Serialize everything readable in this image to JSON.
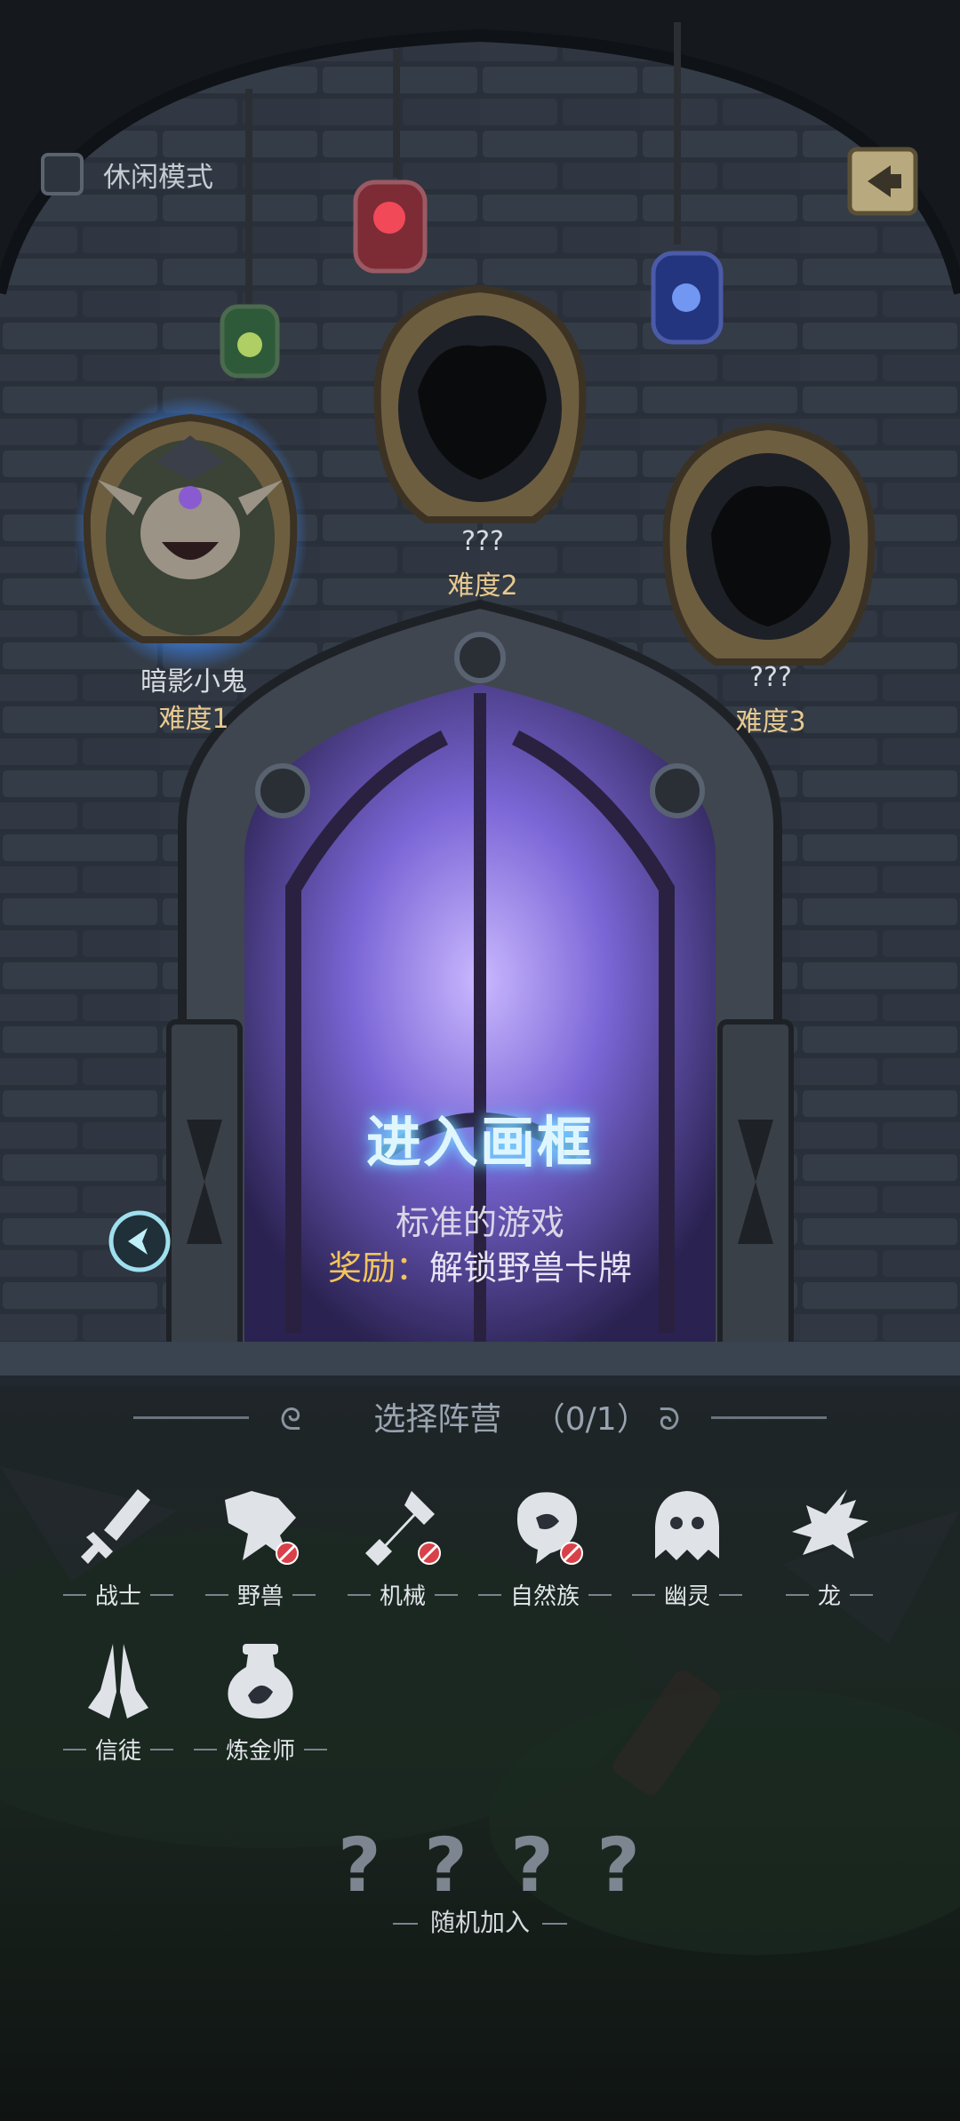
{
  "top": {
    "casual_mode_label": "休闲模式",
    "casual_mode_checked": false,
    "back_icon": "back-arrow-icon"
  },
  "portraits": [
    {
      "name": "暗影小鬼",
      "difficulty": "难度1",
      "unlocked": true,
      "selected": true
    },
    {
      "name": "???",
      "difficulty": "难度2",
      "unlocked": false,
      "selected": false
    },
    {
      "name": "???",
      "difficulty": "难度3",
      "unlocked": false,
      "selected": false
    }
  ],
  "door": {
    "title": "进入画框",
    "description": "标准的游戏",
    "reward_key": "奖励：",
    "reward_value": "解锁野兽卡牌"
  },
  "factions": {
    "header": "选择阵营",
    "count": "（0/1）",
    "items": [
      {
        "label": "战士",
        "icon": "warrior-icon",
        "locked": false
      },
      {
        "label": "野兽",
        "icon": "beast-icon",
        "locked": true
      },
      {
        "label": "机械",
        "icon": "mech-icon",
        "locked": true
      },
      {
        "label": "自然族",
        "icon": "nature-icon",
        "locked": true
      },
      {
        "label": "幽灵",
        "icon": "ghost-icon",
        "locked": false
      },
      {
        "label": "龙",
        "icon": "dragon-icon",
        "locked": false
      },
      {
        "label": "信徒",
        "icon": "believer-icon",
        "locked": false
      },
      {
        "label": "炼金师",
        "icon": "alchemist-icon",
        "locked": false
      }
    ]
  },
  "random": {
    "marks": [
      "?",
      "?",
      "?",
      "?"
    ],
    "label": "随机加入"
  },
  "colors": {
    "wall": "#2a313b",
    "door_glow": "#8f7cff",
    "title_glow": "#7fd8ff",
    "selected_glow": "#3e8cff",
    "reward_key": "#f2c45d",
    "difficulty": "#e8c98f",
    "lock_red": "#d9414a"
  }
}
